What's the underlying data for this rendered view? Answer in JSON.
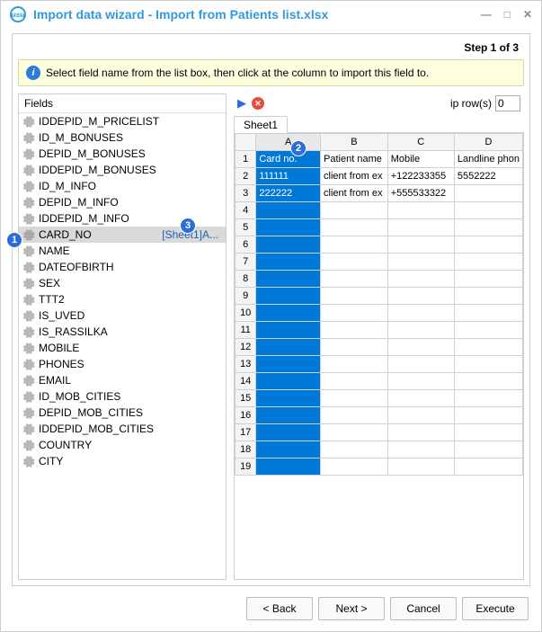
{
  "window": {
    "title": "Import data wizard - Import from Patients list.xlsx",
    "step_label": "Step 1 of 3"
  },
  "info": {
    "text": "Select field name from the list box, then click at the column to import this field to."
  },
  "fields": {
    "header": "Fields",
    "items": [
      {
        "label": "IDDEPID_M_PRICELIST"
      },
      {
        "label": "ID_M_BONUSES"
      },
      {
        "label": "DEPID_M_BONUSES"
      },
      {
        "label": "IDDEPID_M_BONUSES"
      },
      {
        "label": "ID_M_INFO"
      },
      {
        "label": "DEPID_M_INFO"
      },
      {
        "label": "IDDEPID_M_INFO"
      },
      {
        "label": "CARD_NO",
        "mapping": "[Sheet1]A..."
      },
      {
        "label": "NAME"
      },
      {
        "label": "DATEOFBIRTH"
      },
      {
        "label": "SEX"
      },
      {
        "label": "TTT2"
      },
      {
        "label": "IS_UVED"
      },
      {
        "label": "IS_RASSILKA"
      },
      {
        "label": "MOBILE"
      },
      {
        "label": "PHONES"
      },
      {
        "label": "EMAIL"
      },
      {
        "label": "ID_MOB_CITIES"
      },
      {
        "label": "DEPID_MOB_CITIES"
      },
      {
        "label": "IDDEPID_MOB_CITIES"
      },
      {
        "label": "COUNTRY"
      },
      {
        "label": "CITY"
      }
    ]
  },
  "skip": {
    "label": "ip row(s)",
    "value": "0"
  },
  "sheet": {
    "tab": "Sheet1"
  },
  "grid": {
    "cols": [
      "A",
      "B",
      "C",
      "D"
    ],
    "rows": [
      [
        "Card no.",
        "Patient name",
        "Mobile",
        "Landline phon"
      ],
      [
        "111111",
        "client from ex",
        "+122233355",
        "5552222"
      ],
      [
        "222222",
        "client from ex",
        "+555533322",
        ""
      ]
    ],
    "empty_rows": 16
  },
  "buttons": {
    "back": "< Back",
    "next": "Next >",
    "cancel": "Cancel",
    "execute": "Execute"
  },
  "callouts": {
    "c1": "1",
    "c2": "2",
    "c3": "3"
  }
}
